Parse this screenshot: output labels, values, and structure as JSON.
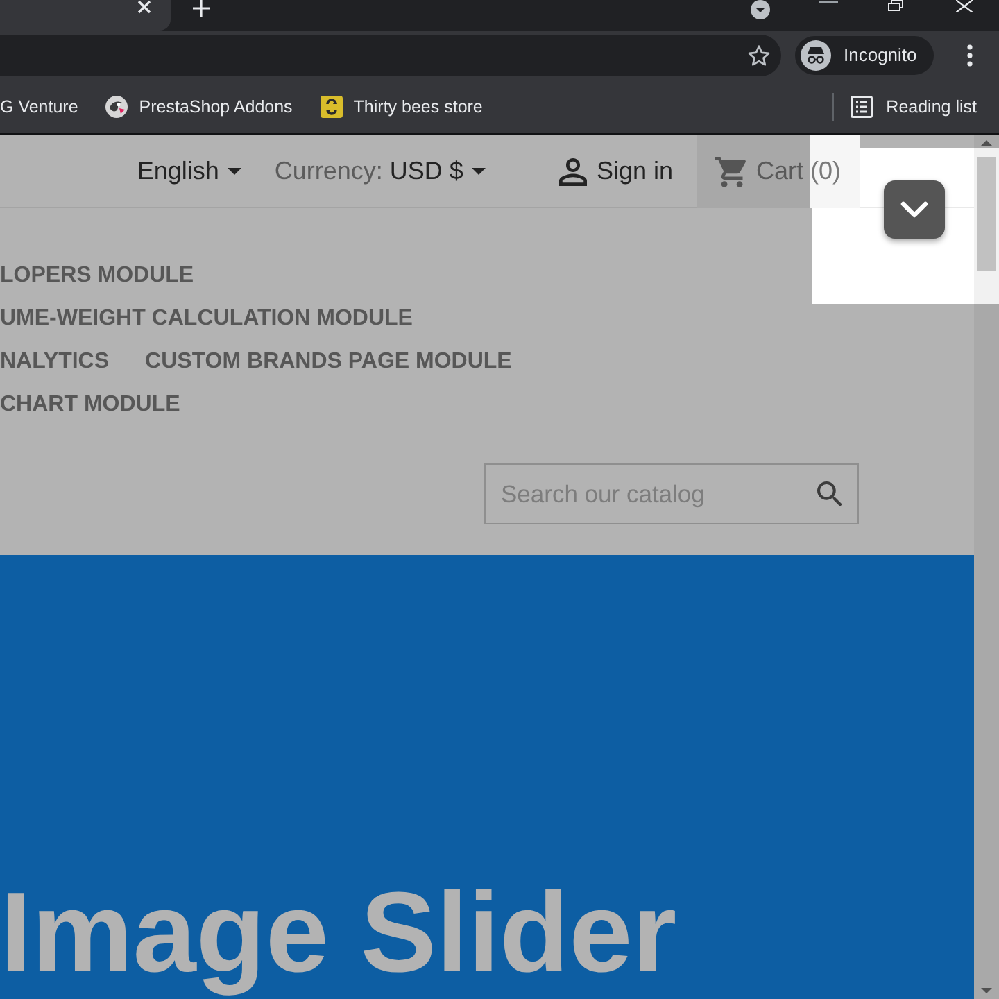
{
  "browser": {
    "profile_label": "Incognito",
    "bookmarks": [
      {
        "kind": "text",
        "label": "G Venture"
      },
      {
        "kind": "bird",
        "label": "PrestaShop Addons"
      },
      {
        "kind": "tile",
        "label": "Thirty bees store"
      }
    ],
    "reading_list": "Reading list"
  },
  "header": {
    "language": "English",
    "currency_label": "Currency:",
    "currency": "USD $",
    "sign_in": "Sign in",
    "cart_label": "Cart",
    "cart_count": "(0)"
  },
  "menu": [
    {
      "items": [
        "LOPERS MODULE"
      ]
    },
    {
      "items": [
        "UME-WEIGHT CALCULATION MODULE"
      ]
    },
    {
      "items": [
        "NALYTICS",
        "CUSTOM BRANDS PAGE MODULE"
      ]
    },
    {
      "items": [
        "CHART MODULE"
      ]
    }
  ],
  "search": {
    "placeholder": "Search our catalog"
  },
  "banner": {
    "title": "Image Slider"
  }
}
